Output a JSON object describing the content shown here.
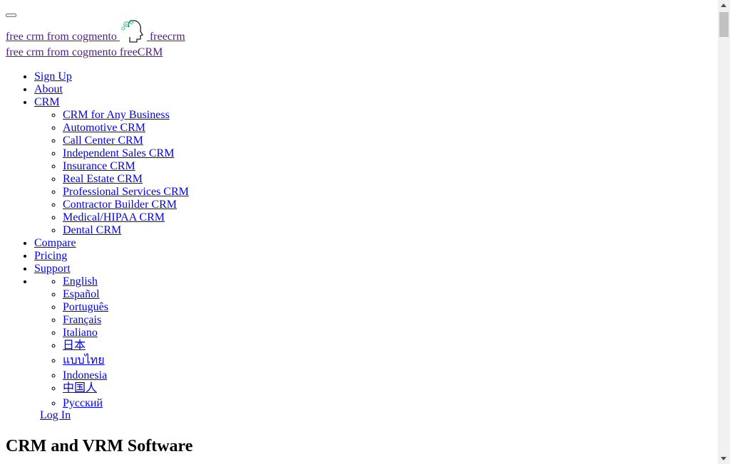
{
  "header": {
    "brand_text": "free crm from cogmento",
    "brand_suffix": "freecrm",
    "tagline_text": "free crm from cogmento freeCRM",
    "logo_icon": "head-with-gears-icon",
    "toggle_icon": "navbar-toggle-icon"
  },
  "nav": {
    "items": [
      {
        "label": "Sign Up"
      },
      {
        "label": "About"
      },
      {
        "label": "CRM",
        "children": [
          "CRM for Any Business",
          "Automotive CRM",
          "Call Center CRM",
          "Independent Sales CRM",
          "Insurance CRM",
          "Real Estate CRM",
          "Professional Services CRM",
          "Contractor Builder CRM",
          "Medical/HIPAA CRM",
          "Dental CRM"
        ]
      },
      {
        "label": "Compare"
      },
      {
        "label": "Pricing"
      },
      {
        "label": "Support"
      }
    ],
    "languages": [
      "English",
      "Español",
      "Português",
      "Français",
      "Italiano",
      "日本",
      "แบบไทย",
      "Indonesia",
      "中国人",
      "Русский"
    ],
    "login_label": "Log In"
  },
  "main": {
    "heading": "CRM and VRM Software"
  },
  "colors": {
    "link": "#0000ee",
    "visited_link": "#551a8b",
    "logo_gear": "#2ecc71"
  }
}
